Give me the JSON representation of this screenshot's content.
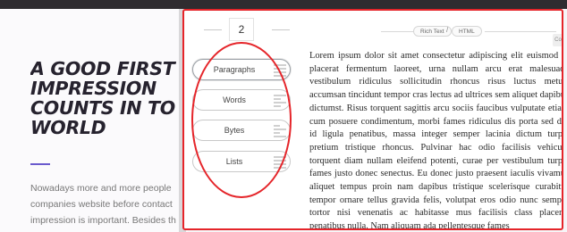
{
  "background_page": {
    "hero_lines": [
      "A GOOD FIRST",
      "IMPRESSION",
      "COUNTS IN TO",
      "WORLD"
    ],
    "body_lines": [
      "Nowadays more and more people",
      "companies website before contact",
      "impression is important. Besides th"
    ]
  },
  "generator": {
    "count": "2",
    "options": [
      {
        "label": "Paragraphs",
        "icon": "paragraph-lines-icon"
      },
      {
        "label": "Words",
        "icon": "words-grid-icon"
      },
      {
        "label": "Bytes",
        "icon": "bytes-icon"
      },
      {
        "label": "Lists",
        "icon": "list-icon"
      }
    ],
    "formats": [
      "Rich Text",
      "HTML"
    ],
    "format_separator": "/",
    "copy_tab": "Co",
    "output_text": "Lorem ipsum dolor sit amet consectetur adipiscing elit euismod et placerat fermentum laoreet, urna nullam arcu erat malesuada vestibulum ridiculus sollicitudin rhoncus risus luctus metus, accumsan tincidunt tempor cras lectus ad ultrices sem aliquet dapibus dictumst. Risus torquent sagittis arcu sociis faucibus vulputate etiam cum posuere condimentum, morbi fames ridiculus dis porta sed dui id ligula penatibus, massa integer semper lacinia dictum turpis pretium tristique rhoncus. Pulvinar hac odio facilisis vehicula torquent diam nullam eleifend potenti, curae per vestibulum turpis fames justo donec senectus. Eu donec justo praesent iaculis vivamus aliquet tempus proin nam dapibus tristique scelerisque curabitur tempor ornare tellus gravida felis, volutpat eros odio nunc semper tortor nisi venenatis ac habitasse mus facilisis class placerat penatibus nulla. Nam aliquam ada pellentesque fames"
  },
  "colors": {
    "annotation_red": "#e5252a",
    "accent": "#6a5acd",
    "topbar": "#2f2c30"
  }
}
